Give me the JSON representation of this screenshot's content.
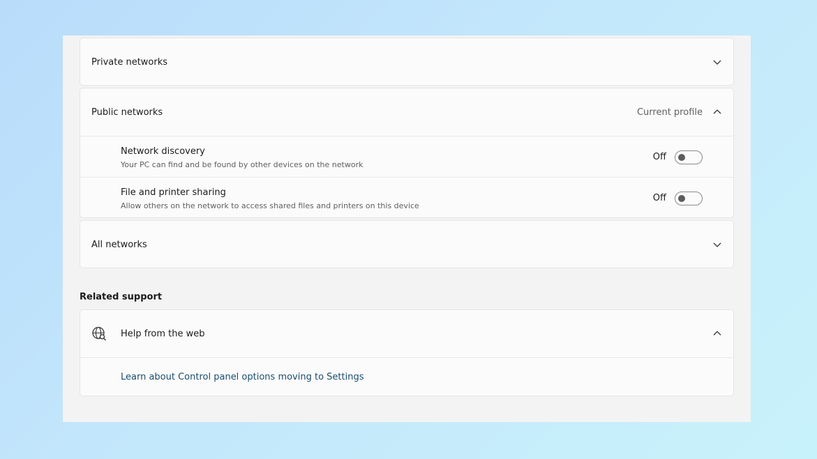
{
  "private_networks": {
    "label": "Private networks"
  },
  "public_networks": {
    "label": "Public networks",
    "status": "Current profile",
    "settings": [
      {
        "title": "Network discovery",
        "description": "Your PC can find and be found by other devices on the network",
        "state": "Off"
      },
      {
        "title": "File and printer sharing",
        "description": "Allow others on the network to access shared files and printers on this device",
        "state": "Off"
      }
    ]
  },
  "all_networks": {
    "label": "All networks"
  },
  "related_support": {
    "heading": "Related support",
    "help_title": "Help from the web",
    "link_text": "Learn about Control panel options moving to Settings"
  },
  "icons": {
    "expand": "chevron-down-icon",
    "collapse": "chevron-up-icon",
    "help": "globe-search-icon"
  }
}
